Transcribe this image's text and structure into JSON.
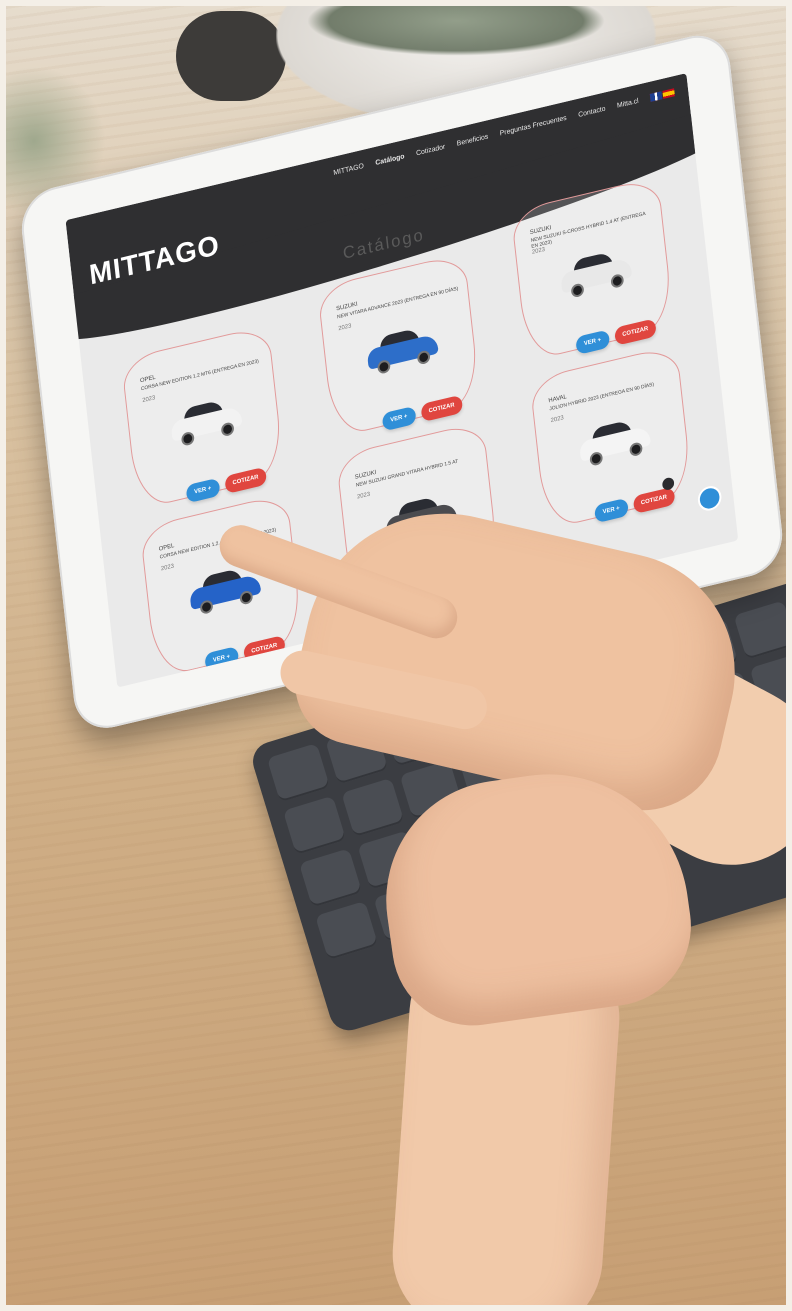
{
  "photo": {
    "description_label": ""
  },
  "site": {
    "logo": "MITTAGO",
    "nav": [
      {
        "label": "MITTAGO"
      },
      {
        "label": "Catálogo"
      },
      {
        "label": "Cotizador"
      },
      {
        "label": "Beneficios"
      },
      {
        "label": "Preguntas Frecuentes"
      },
      {
        "label": "Contacto"
      },
      {
        "label": "Mitta.cl"
      }
    ],
    "page_title": "Catálogo",
    "buttons": {
      "ver": "VER +",
      "cotizar": "COTIZAR"
    },
    "cards": [
      {
        "brand": "OPEL",
        "model": "CORSA NEW EDITION 1.2 MT6 (ENTREGA EN 2023)",
        "year": "2023",
        "car_color": "#f2f2f2"
      },
      {
        "brand": "SUZUKI",
        "model": "NEW VITARA ADVANCE 2023 (ENTREGA EN 90 DÍAS)",
        "year": "2023",
        "car_color": "#2d6ec9"
      },
      {
        "brand": "SUZUKI",
        "model": "NEW SUZUKI S-CROSS HYBRID 1.4 AT (ENTREGA EN 2023)",
        "year": "2023",
        "car_color": "#e8e8e8"
      },
      {
        "brand": "OPEL",
        "model": "CORSA NEW EDITION 1.2 AT8 (ENTREGA EN 2023)",
        "year": "2023",
        "car_color": "#2563c8"
      },
      {
        "brand": "SUZUKI",
        "model": "NEW SUZUKI GRAND VITARA HYBRID 1.5 AT",
        "year": "2023",
        "car_color": "#4b4b4f"
      },
      {
        "brand": "HAVAL",
        "model": "JOLION HYBRID 2023 (ENTREGA EN 90 DÍAS)",
        "year": "2023",
        "car_color": "#f4f4f4"
      }
    ]
  },
  "colors": {
    "header": "#2f2f31",
    "ver_button": "#2f8fd8",
    "cotizar_button": "#e0463f",
    "card_border": "#e29a9a"
  }
}
